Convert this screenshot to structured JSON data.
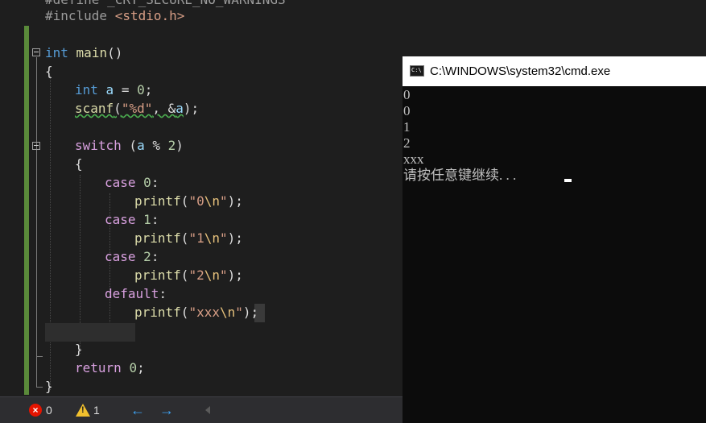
{
  "editor": {
    "lines": {
      "define": "#define _CRT_SECURE_NO_WARNINGS",
      "include_directive": "#include",
      "include_header": "<stdio.h>",
      "main_type": "int",
      "main_name": "main",
      "main_parens": "()",
      "brace_open": "{",
      "decl_type": "int",
      "decl_var": "a",
      "decl_rest": " = ",
      "decl_val": "0",
      "decl_end": ";",
      "scanf_fn": "scanf",
      "scanf_open": "(",
      "scanf_fmt": "\"%d\"",
      "scanf_comma": ", &",
      "scanf_var": "a",
      "scanf_close": ");",
      "switch_kw": "switch",
      "switch_open": " (",
      "switch_var": "a",
      "switch_op": " % ",
      "switch_num": "2",
      "switch_close": ")",
      "inner_brace_open": "{",
      "case0_kw": "case",
      "case0_val": "0",
      "case0_colon": ":",
      "printf0_fn": "printf",
      "printf0_open": "(",
      "printf0_str": "\"0",
      "printf0_esc": "\\n",
      "printf0_q": "\"",
      "printf0_close": ");",
      "case1_kw": "case",
      "case1_val": "1",
      "case1_colon": ":",
      "printf1_fn": "printf",
      "printf1_open": "(",
      "printf1_str": "\"1",
      "printf1_esc": "\\n",
      "printf1_q": "\"",
      "printf1_close": ");",
      "case2_kw": "case",
      "case2_val": "2",
      "case2_colon": ":",
      "printf2_fn": "printf",
      "printf2_open": "(",
      "printf2_str": "\"2",
      "printf2_esc": "\\n",
      "printf2_q": "\"",
      "printf2_close": ");",
      "default_kw": "default",
      "default_colon": ":",
      "printfd_fn": "printf",
      "printfd_open": "(",
      "printfd_str": "\"xxx",
      "printfd_esc": "\\n",
      "printfd_q": "\"",
      "printfd_close": ");",
      "inner_brace_close": "}",
      "return_kw": "return",
      "return_val": "0",
      "return_end": ";",
      "brace_close": "}"
    }
  },
  "status_bar": {
    "error_count": "0",
    "warning_count": "1",
    "back_arrow": "←",
    "forward_arrow": "→"
  },
  "console": {
    "title": "C:\\WINDOWS\\system32\\cmd.exe",
    "icon_text": "C:\\",
    "output": [
      "0",
      "0",
      "1",
      "2",
      "xxx",
      "请按任意键继续. . ."
    ]
  }
}
